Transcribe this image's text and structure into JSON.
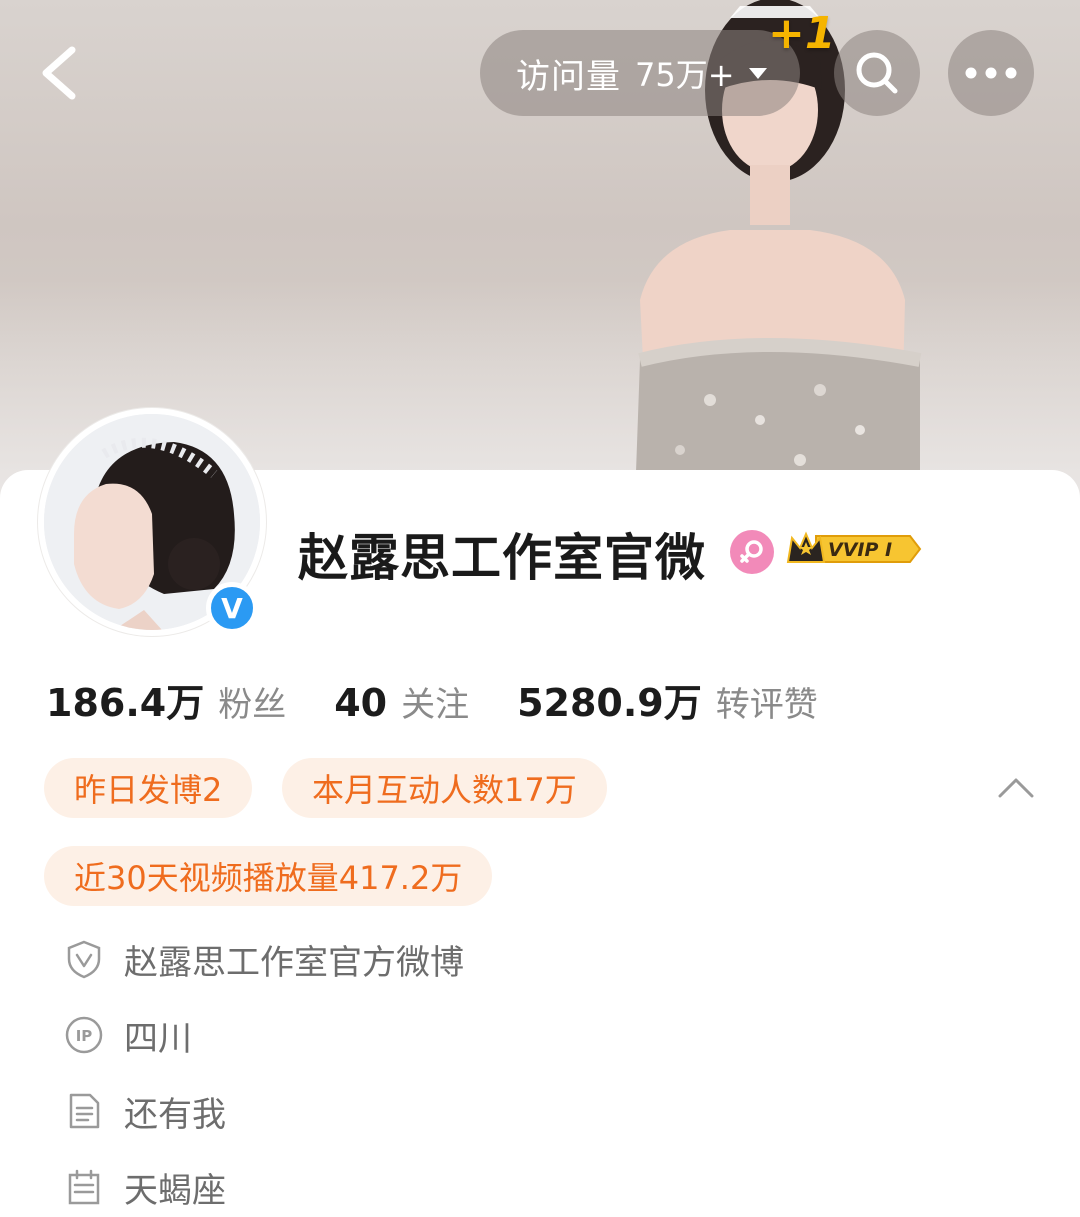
{
  "header": {
    "visits_label": "访问量",
    "visits_value": "75万+",
    "plus_one": "+1"
  },
  "profile": {
    "name": "赵露思工作室官微",
    "vip_label": "VVIP I",
    "verified_mark": "V"
  },
  "stats": [
    {
      "value": "186.4万",
      "label": "粉丝"
    },
    {
      "value": "40",
      "label": "关注"
    },
    {
      "value": "5280.9万",
      "label": "转评赞"
    }
  ],
  "chips": {
    "posts_yesterday": "昨日发博2",
    "monthly_interactions": "本月互动人数17万",
    "video_views_30d": "近30天视频播放量417.2万"
  },
  "info": {
    "verification": "赵露思工作室官方微博",
    "ip_location": "四川",
    "bio": "还有我",
    "zodiac": "天蝎座"
  },
  "icons": {
    "back": "back-arrow-icon",
    "search": "search-icon",
    "more": "more-icon",
    "collapse": "chevron-up-icon"
  },
  "colors": {
    "chip_bg": "#fdf0e6",
    "chip_text": "#ef6c1e",
    "verified_blue": "#2b9af3",
    "vip_gold": "#f5b400"
  }
}
